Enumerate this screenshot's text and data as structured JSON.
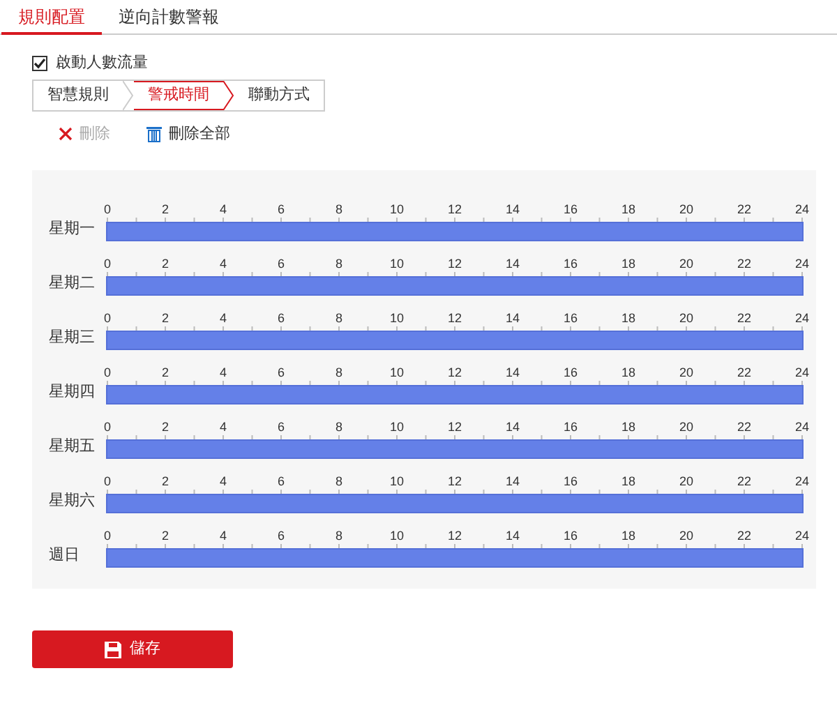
{
  "top_tabs": [
    {
      "label": "規則配置",
      "selected": true
    },
    {
      "label": "逆向計數警報",
      "selected": false
    }
  ],
  "enable": {
    "label": "啟動人數流量",
    "checked": true
  },
  "step_tabs": [
    {
      "label": "智慧規則",
      "selected": false
    },
    {
      "label": "警戒時間",
      "selected": true
    },
    {
      "label": "聯動方式",
      "selected": false
    }
  ],
  "toolbar": [
    {
      "kind": "delete",
      "label": "刪除",
      "disabled": true
    },
    {
      "kind": "delete_all",
      "label": "刪除全部",
      "disabled": false
    }
  ],
  "schedule": [
    {
      "day": "星期一",
      "level": 1,
      "ticks": [
        "0",
        "2",
        "4",
        "6",
        "8",
        "10",
        "12",
        "14",
        "16",
        "18",
        "20",
        "22",
        "24"
      ]
    },
    {
      "day": "星期二",
      "level": 1,
      "ticks": [
        "0",
        "2",
        "4",
        "6",
        "8",
        "10",
        "12",
        "14",
        "16",
        "18",
        "20",
        "22",
        "24"
      ]
    },
    {
      "day": "星期三",
      "level": 1,
      "ticks": [
        "0",
        "2",
        "4",
        "6",
        "8",
        "10",
        "12",
        "14",
        "16",
        "18",
        "20",
        "22",
        "24"
      ]
    },
    {
      "day": "星期四",
      "level": 1,
      "ticks": [
        "0",
        "2",
        "4",
        "6",
        "8",
        "10",
        "12",
        "14",
        "16",
        "18",
        "20",
        "22",
        "24"
      ]
    },
    {
      "day": "星期五",
      "level": 1,
      "ticks": [
        "0",
        "2",
        "4",
        "6",
        "8",
        "10",
        "12",
        "14",
        "16",
        "18",
        "20",
        "22",
        "24"
      ]
    },
    {
      "day": "星期六",
      "level": 1,
      "ticks": [
        "0",
        "2",
        "4",
        "6",
        "8",
        "10",
        "12",
        "14",
        "16",
        "18",
        "20",
        "22",
        "24"
      ]
    },
    {
      "day": "週日",
      "level": 1,
      "ticks": [
        "0",
        "2",
        "4",
        "6",
        "8",
        "10",
        "12",
        "14",
        "16",
        "18",
        "20",
        "22",
        "24"
      ]
    }
  ],
  "save_button": {
    "label": "儲存"
  }
}
